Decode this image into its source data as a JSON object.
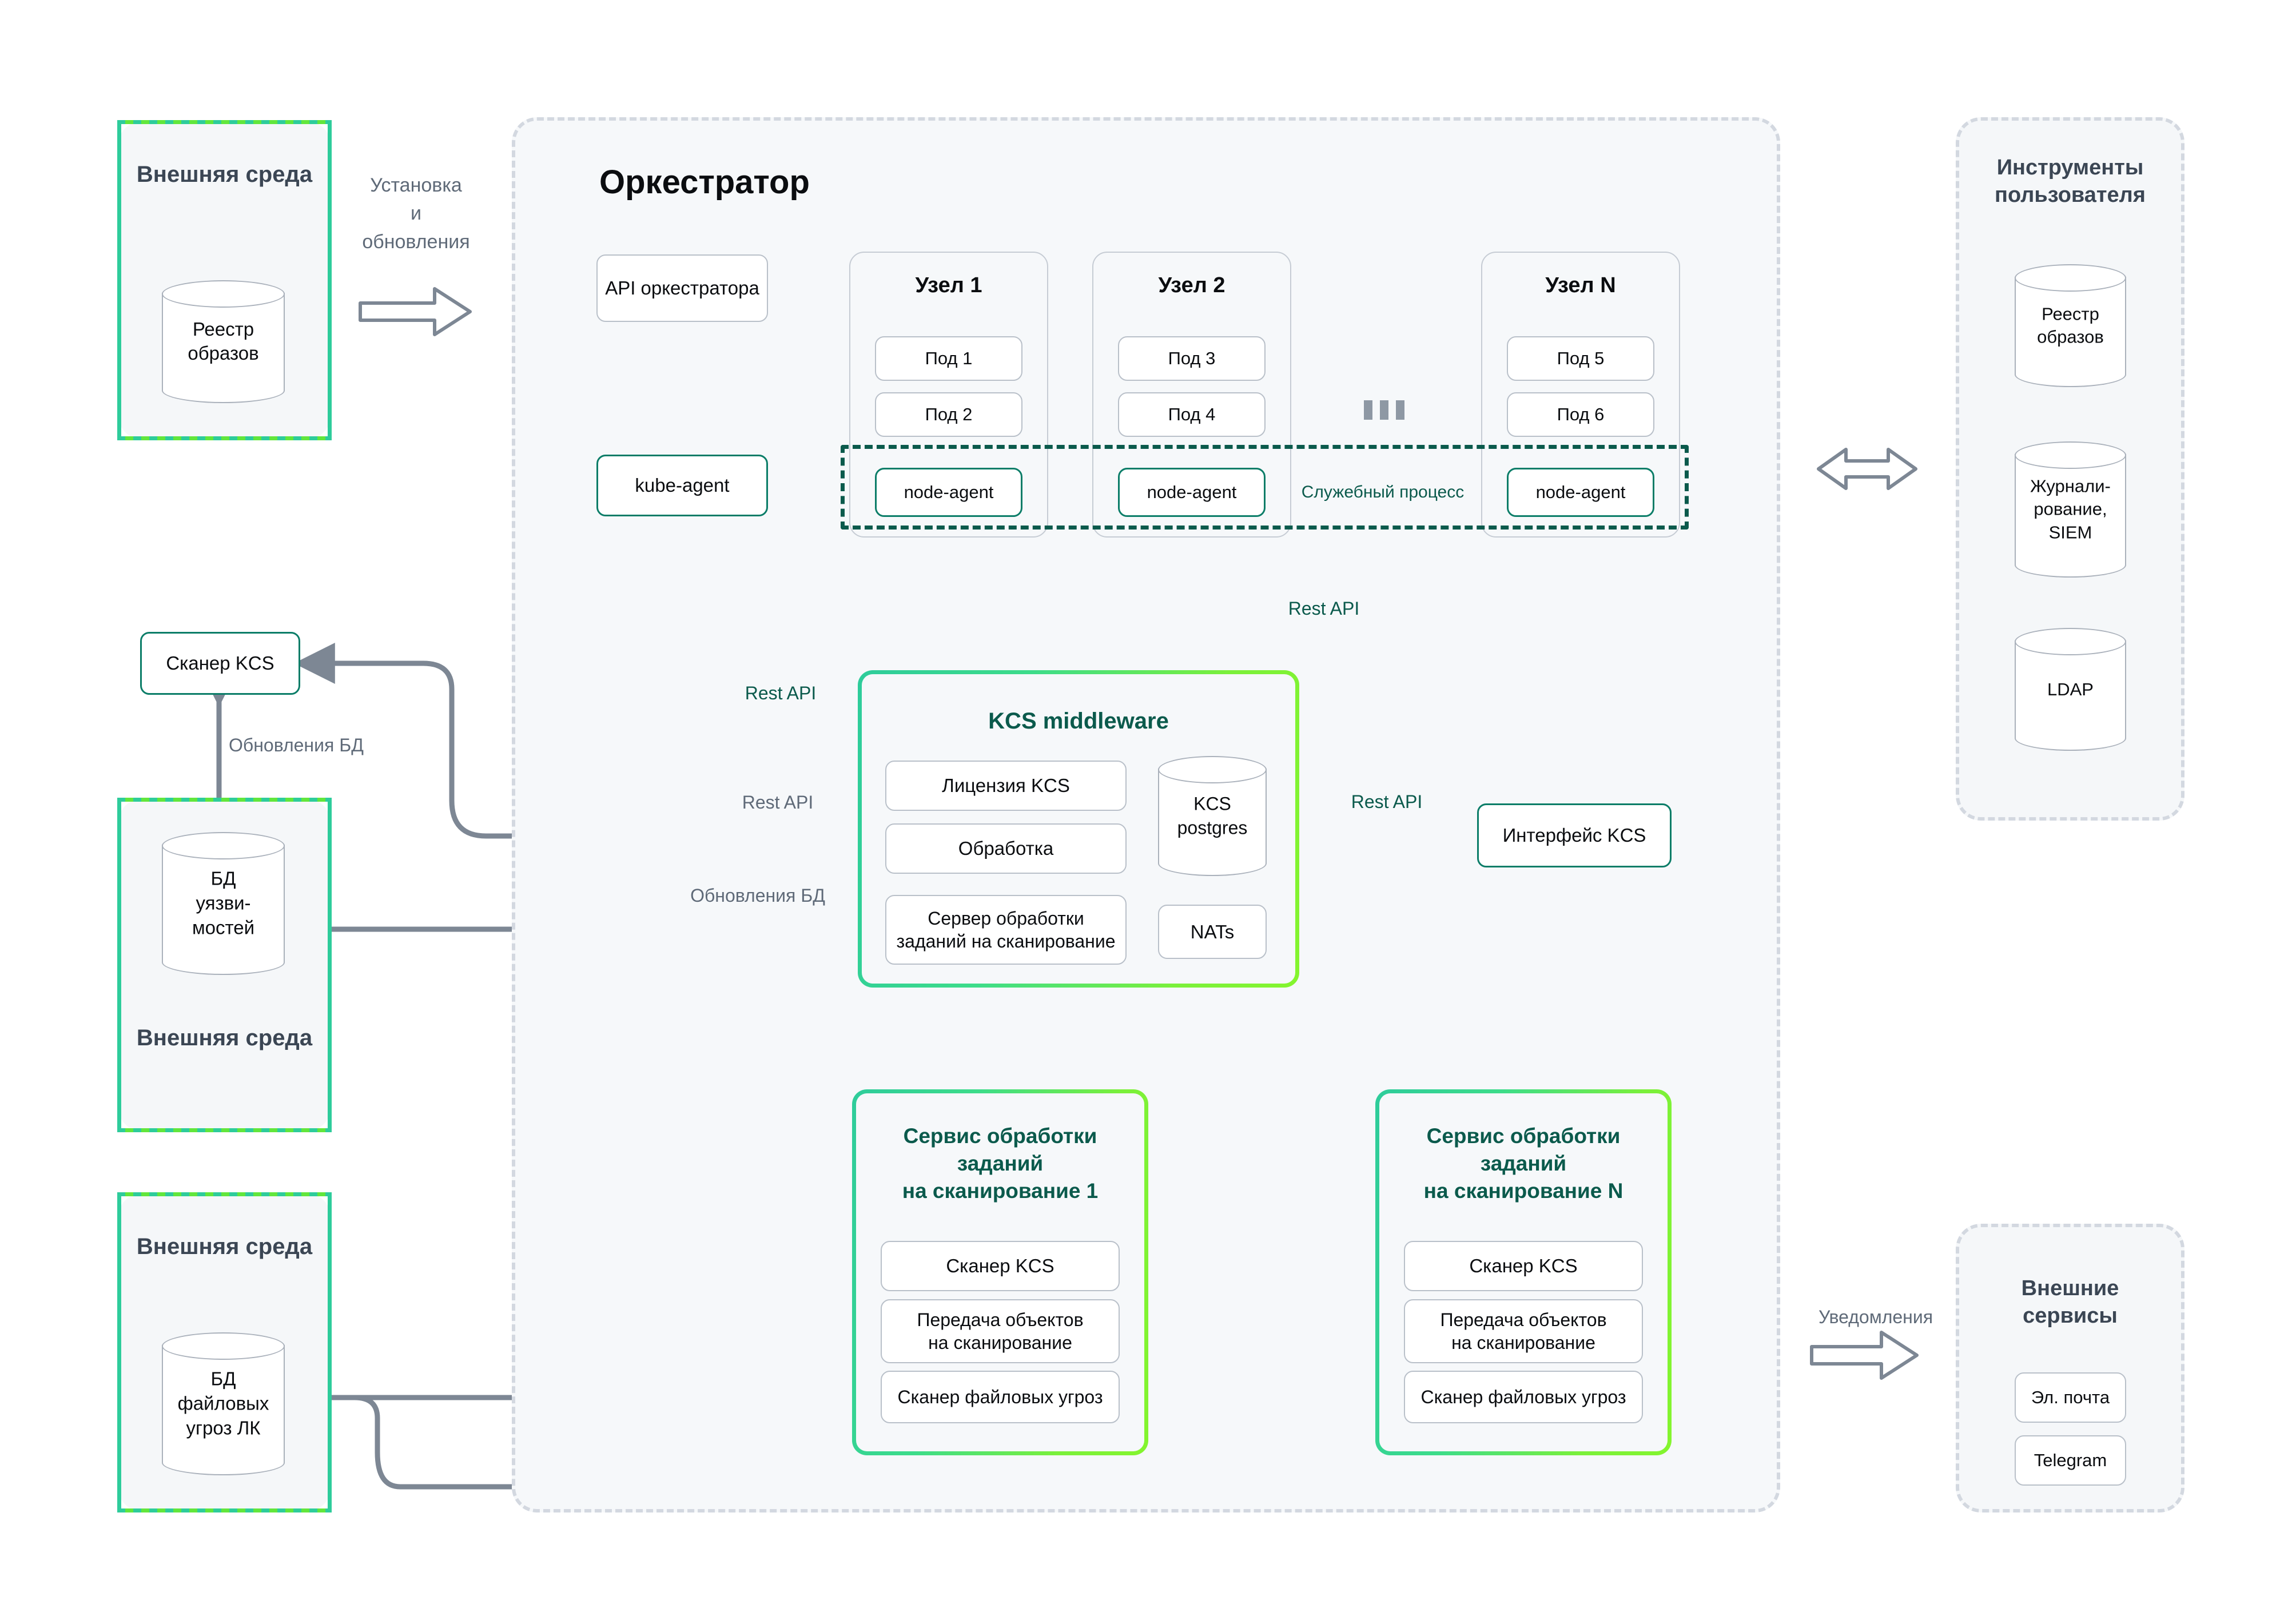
{
  "diagram": {
    "title_orchestrator": "Оркестратор"
  },
  "left_top_env": {
    "title": "Внешняя среда",
    "db_label": "Реестр образов",
    "arrow_label": "Установка\nи\nобновления"
  },
  "orchestrator": {
    "api_box": "API оркестратора",
    "kube_agent": "kube-agent",
    "service_process_label": "Служебный процесс",
    "ellipsis": "...",
    "nodes": [
      {
        "title": "Узел 1",
        "pods": [
          "Под 1",
          "Под 2"
        ],
        "agent": "node-agent"
      },
      {
        "title": "Узел 2",
        "pods": [
          "Под 3",
          "Под 4"
        ],
        "agent": "node-agent"
      },
      {
        "title": "Узел N",
        "pods": [
          "Под 5",
          "Под 6"
        ],
        "agent": "node-agent"
      }
    ],
    "rest_api_nodes_label": "Rest API"
  },
  "middleware": {
    "title": "KCS middleware",
    "items": [
      "Лицензия KCS",
      "Обработка",
      "Сервер обработки заданий на сканирование"
    ],
    "db_label": "KCS postgres",
    "nats": "NATs",
    "rest_api_left_teal": "Rest API",
    "rest_api_left_gray": "Rest API",
    "rest_api_right": "Rest API",
    "db_updates_gray": "Обновления БД"
  },
  "interface_box": {
    "label": "Интерфейс KCS"
  },
  "scan_services": [
    {
      "title": "Сервис обработки заданий\nна сканирование 1",
      "items": [
        "Сканер KCS",
        "Передача объектов на сканирование",
        "Сканер файловых угроз"
      ]
    },
    {
      "title": "Сервис обработки заданий\nна сканирование N",
      "items": [
        "Сканер KCS",
        "Передача объектов на сканирование",
        "Сканер файловых угроз"
      ]
    }
  ],
  "left_scanner": {
    "label": "Сканер KCS",
    "db_updates_label": "Обновления БД"
  },
  "left_mid_env": {
    "db_label": "БД уязви-мостей",
    "title": "Внешняя среда"
  },
  "left_bottom_env": {
    "title": "Внешняя среда",
    "db_label": "БД файловых угроз ЛК"
  },
  "user_tools": {
    "title": "Инструменты пользователя",
    "dbs": [
      "Реестр образов",
      "Журнали-рование, SIEM",
      "LDAP"
    ]
  },
  "external_services": {
    "title": "Внешние сервисы",
    "notifications_label": "Уведомления",
    "items": [
      "Эл. почта",
      "Telegram"
    ]
  },
  "colors": {
    "teal": "#0b7d68",
    "teal_dark": "#0b5a4c",
    "green_light": "#62e63c",
    "green_mint": "#2ecc9b",
    "gray_line": "#7d8794",
    "panel_bg": "#f5f7f9",
    "dashed_gray": "#d3d8e0"
  }
}
